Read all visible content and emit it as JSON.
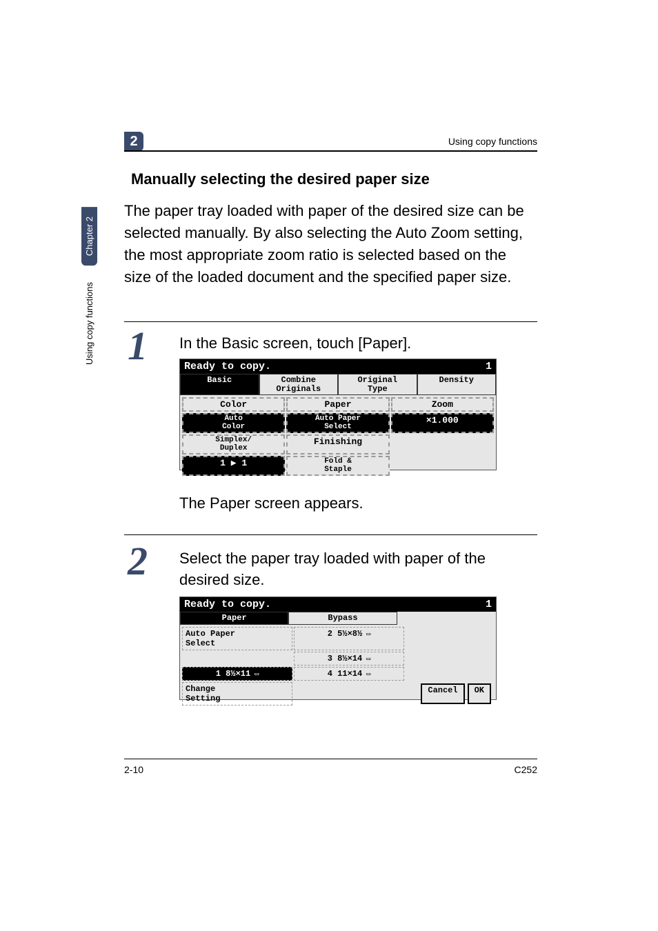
{
  "header": {
    "chapter_badge": "2",
    "running_head": "Using copy functions"
  },
  "sidebar": {
    "tab_dark": "Chapter 2",
    "tab_light": "Using copy functions"
  },
  "section": {
    "title": "Manually selecting the desired paper size",
    "intro": "The paper tray loaded with paper of the desired size can be selected manually. By also selecting the Auto Zoom setting, the most appropriate zoom ratio is selected based on the size of the loaded document and the specified paper size."
  },
  "steps": {
    "s1": {
      "num": "1",
      "text": "In the Basic screen, touch [Paper]."
    },
    "s1_after": "The Paper screen appears.",
    "s2": {
      "num": "2",
      "text": "Select the paper tray loaded with paper of the desired size."
    }
  },
  "lcd1": {
    "ready": "Ready to copy.",
    "count": "1",
    "tabs": {
      "basic": "Basic",
      "combine": "Combine\nOriginals",
      "original": "Original\nType",
      "density": "Density"
    },
    "cells": {
      "color_t": "Color",
      "color_v": "Auto\nColor",
      "paper_t": "Paper",
      "paper_v": "Auto Paper\nSelect",
      "zoom_t": "Zoom",
      "zoom_v": "×1.000",
      "duplex_t": "Simplex/\nDuplex",
      "duplex_v": "1 ▶ 1",
      "finishing": "Finishing",
      "fold": "Fold &\nStaple"
    }
  },
  "lcd2": {
    "ready": "Ready to copy.",
    "count": "1",
    "col_paper": "Paper",
    "col_bypass": "Bypass",
    "auto": "Auto Paper\nSelect",
    "tray1": "1  8½×11",
    "tray2": "2  5½×8½",
    "tray3": "3  8½×14",
    "tray4": "4  11×14",
    "change": "Change\nSetting",
    "cancel": "Cancel",
    "ok": "OK"
  },
  "footer": {
    "left": "2-10",
    "right": "C252"
  }
}
